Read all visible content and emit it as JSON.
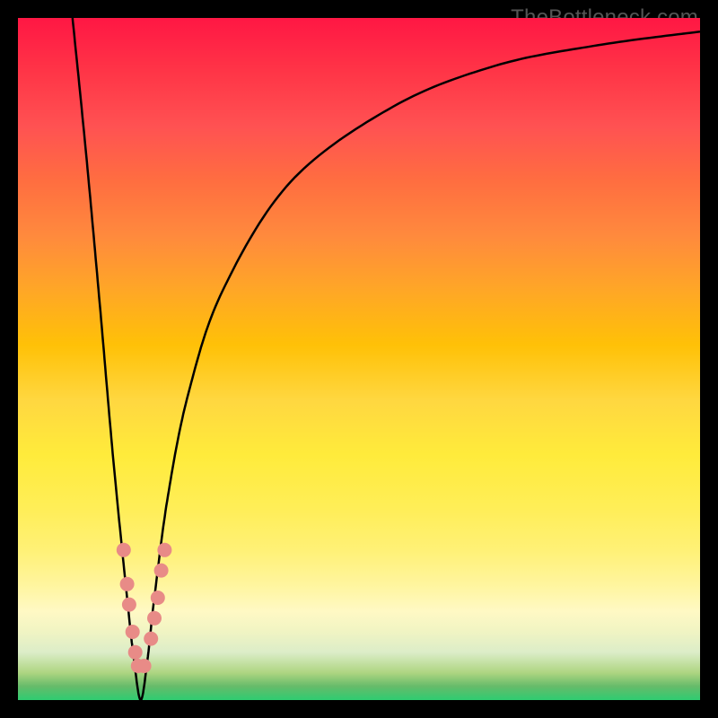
{
  "watermark": "TheBottleneck.com",
  "chart_data": {
    "type": "line",
    "title": "",
    "xlabel": "",
    "ylabel": "",
    "xlim": [
      0,
      100
    ],
    "ylim": [
      0,
      100
    ],
    "background_gradient": {
      "description": "vertical gradient from red (top, high bottleneck) through orange/yellow to green (bottom, no bottleneck)",
      "stops": [
        {
          "pos": 0,
          "color": "#ff1744"
        },
        {
          "pos": 50,
          "color": "#ffd740"
        },
        {
          "pos": 85,
          "color": "#fff9c4"
        },
        {
          "pos": 100,
          "color": "#2ecc71"
        }
      ]
    },
    "series": [
      {
        "name": "bottleneck-curve",
        "description": "V-shaped curve: steep fall on left, sharp valley near x≈18, asymptotic rise toward top-right",
        "x": [
          8,
          10,
          12,
          14,
          16,
          17,
          18,
          19,
          20,
          22,
          25,
          30,
          40,
          55,
          70,
          85,
          100
        ],
        "y": [
          100,
          80,
          58,
          35,
          15,
          6,
          0,
          6,
          15,
          30,
          45,
          60,
          76,
          87,
          93,
          96,
          98
        ]
      }
    ],
    "markers": [
      {
        "name": "left-cluster",
        "x": [
          15.5,
          16,
          16.3,
          16.8,
          17.2,
          17.6
        ],
        "y": [
          22,
          17,
          14,
          10,
          7,
          5
        ],
        "color": "#e88b87"
      },
      {
        "name": "right-cluster",
        "x": [
          18.5,
          19.5,
          20,
          20.5,
          21,
          21.5
        ],
        "y": [
          5,
          9,
          12,
          15,
          19,
          22
        ],
        "color": "#e88b87"
      }
    ]
  }
}
